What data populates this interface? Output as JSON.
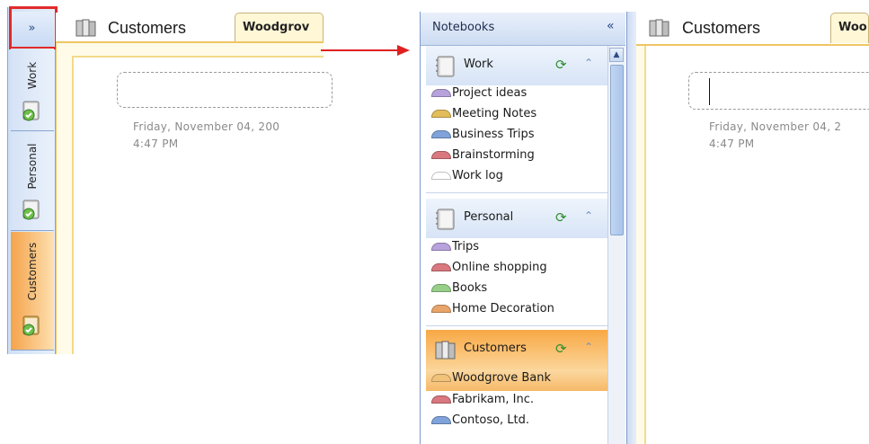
{
  "left": {
    "expand_label": "»",
    "section_title": "Customers",
    "page_tab": "Woodgrov",
    "date": "Friday, November 04, 200",
    "time": "4:47 PM",
    "notebook_tabs": [
      "Work",
      "Personal",
      "Customers"
    ]
  },
  "right": {
    "nav_title": "Notebooks",
    "collapse_label": "«",
    "section_title": "Customers",
    "page_tab": "Woo",
    "date": "Friday, November 04, 2",
    "time": "4:47 PM",
    "notebooks": [
      {
        "name": "Work",
        "sections": [
          {
            "label": "Project ideas",
            "color": "#b8a2dc"
          },
          {
            "label": "Meeting Notes",
            "color": "#e3bd5a"
          },
          {
            "label": "Business Trips",
            "color": "#7fa3da"
          },
          {
            "label": "Brainstorming",
            "color": "#d9787e"
          },
          {
            "label": "Work log",
            "color": "#ffffff"
          }
        ]
      },
      {
        "name": "Personal",
        "sections": [
          {
            "label": "Trips",
            "color": "#b8a2dc"
          },
          {
            "label": "Online shopping",
            "color": "#d9787e"
          },
          {
            "label": "Books",
            "color": "#97cf89"
          },
          {
            "label": "Home Decoration",
            "color": "#e8a56a"
          }
        ]
      },
      {
        "name": "Customers",
        "sections": [
          {
            "label": "Woodgrove Bank",
            "color": "#f1c27a"
          },
          {
            "label": "Fabrikam, Inc.",
            "color": "#d9787e"
          },
          {
            "label": "Contoso, Ltd.",
            "color": "#7fa3da"
          }
        ]
      }
    ]
  },
  "colors": {
    "highlight": "#e12a2a",
    "active_notebook": "#f8a845",
    "page_border": "#f0c564"
  },
  "icons": {
    "notebook": "notebook-icon",
    "sync": "sync-icon",
    "collapse": "chevron-up-icon"
  }
}
